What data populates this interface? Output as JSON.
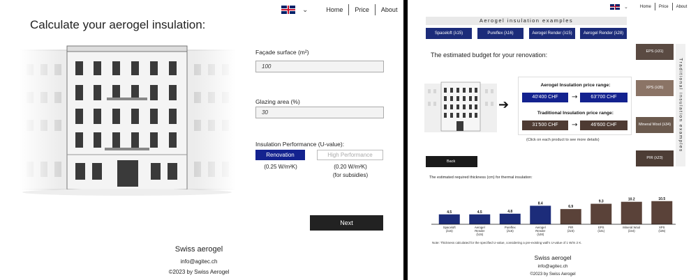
{
  "colors": {
    "accent_blue": "#13228f",
    "product_blue": "#1c2c7a",
    "traditional_brown": "#4e3b33",
    "dark_button": "#222222"
  },
  "left": {
    "nav": {
      "flag_icon": "uk-flag-icon",
      "items": [
        "Home",
        "Price",
        "About"
      ]
    },
    "title": "Calculate your aerogel insulation:",
    "facade_label": "Façade surface (m²)",
    "facade_value": "100",
    "glazing_label": "Glazing area (%)",
    "glazing_value": "30",
    "uvalue_label": "Insulation Performance (U-value):",
    "options": [
      {
        "label": "Renovation",
        "note": "(0.25 W/m²K)",
        "selected": true
      },
      {
        "label": "High Performance",
        "note": "(0.20 W/m²K)",
        "note2": "(for subsidies)",
        "selected": false
      }
    ],
    "next_label": "Next",
    "footer": {
      "title": "Swiss aerogel",
      "email": "info@agitec.ch",
      "copyright": "©2023 by Swiss Aerogel"
    }
  },
  "right": {
    "nav": {
      "flag_icon": "uk-flag-icon",
      "items": [
        "Home",
        "Price",
        "About"
      ]
    },
    "aerogel_header": "Aerogel insulation examples",
    "products": [
      "Spaceloft (λ15)",
      "Pureflex (λ16)",
      "Aerogel Render (λ15)",
      "Aerogel Render (λ28)"
    ],
    "budget_title": "The estimated budget for your renovation:",
    "aerogel_range_title": "Aerogel Insulation price range:",
    "aerogel_min": "40'400 CHF",
    "aerogel_max": "63'700 CHF",
    "traditional_range_title": "Traditional Insulation price range:",
    "traditional_min": "31'500 CHF",
    "traditional_max": "46'600 CHF",
    "click_note": "(Click on each product to see more details)",
    "traditional_header": "Traditional insulation examples",
    "traditional_products": [
      "EPS (λ31)",
      "XPS (λ35)",
      "Mineral Wool (λ34)",
      "PIR (λ23)"
    ],
    "back_label": "Back",
    "thickness_title": "The estimated required thickness (cm) for thermal insulation:",
    "chart_note": "Note: Thickness calculated for the specified U-value, considering a pre-existing wall's U-value of 1 W/m 2 K.",
    "footer": {
      "title": "Swiss aerogel",
      "email": "info@agitec.ch",
      "copyright": "©2023 by Swiss Aerogel"
    }
  },
  "chart_data": {
    "type": "bar",
    "title": "The estimated required thickness (cm) for thermal insulation:",
    "categories": [
      [
        "Spaceloft",
        "(λ15)"
      ],
      [
        "Aerogel",
        "Render",
        "(λ15)"
      ],
      [
        "Pureflex",
        "(λ16)"
      ],
      [
        "Aerogel",
        "Render",
        "(λ28)"
      ],
      [
        "PIR",
        "(λ23)"
      ],
      [
        "EPS",
        "(λ31)"
      ],
      [
        "Mineral Wool",
        "(λ34)"
      ],
      [
        "XPS",
        "(λ35)"
      ]
    ],
    "values": [
      4.5,
      4.5,
      4.8,
      8.4,
      6.9,
      9.3,
      10.2,
      10.5
    ],
    "value_labels": [
      "4.5",
      "4.5",
      "4.8",
      "8.4",
      "6.9",
      "9.3",
      "10.2",
      "10.5"
    ],
    "bar_colors": [
      "#1c2c7a",
      "#1c2c7a",
      "#1c2c7a",
      "#1c2c7a",
      "#5a4239",
      "#5a4239",
      "#5a4239",
      "#5a4239"
    ],
    "ylim": [
      0,
      12
    ],
    "grid": false,
    "legend": "none"
  }
}
